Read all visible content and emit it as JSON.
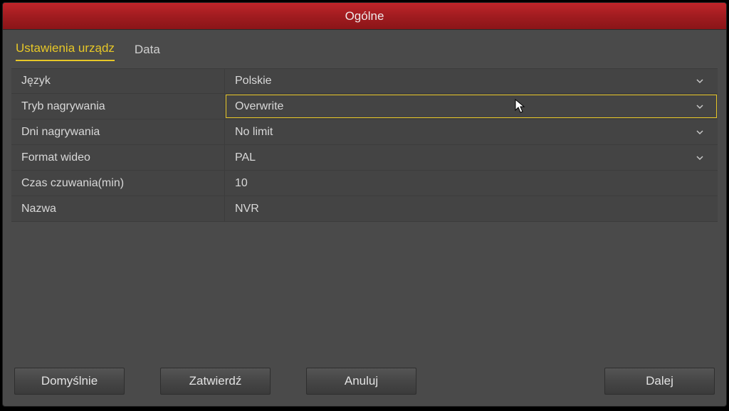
{
  "title": "Ogólne",
  "tabs": [
    {
      "label": "Ustawienia urządz",
      "active": true
    },
    {
      "label": "Data",
      "active": false
    }
  ],
  "rows": [
    {
      "label": "Język",
      "value": "Polskie",
      "type": "dropdown",
      "active": false
    },
    {
      "label": "Tryb nagrywania",
      "value": "Overwrite",
      "type": "dropdown",
      "active": true
    },
    {
      "label": "Dni nagrywania",
      "value": "No limit",
      "type": "dropdown",
      "active": false
    },
    {
      "label": "Format wideo",
      "value": "PAL",
      "type": "dropdown",
      "active": false
    },
    {
      "label": "Czas czuwania(min)",
      "value": "10",
      "type": "input",
      "active": false
    },
    {
      "label": "Nazwa",
      "value": "NVR",
      "type": "input",
      "active": false
    }
  ],
  "buttons": {
    "default": "Domyślnie",
    "apply": "Zatwierdź",
    "cancel": "Anuluj",
    "next": "Dalej"
  }
}
